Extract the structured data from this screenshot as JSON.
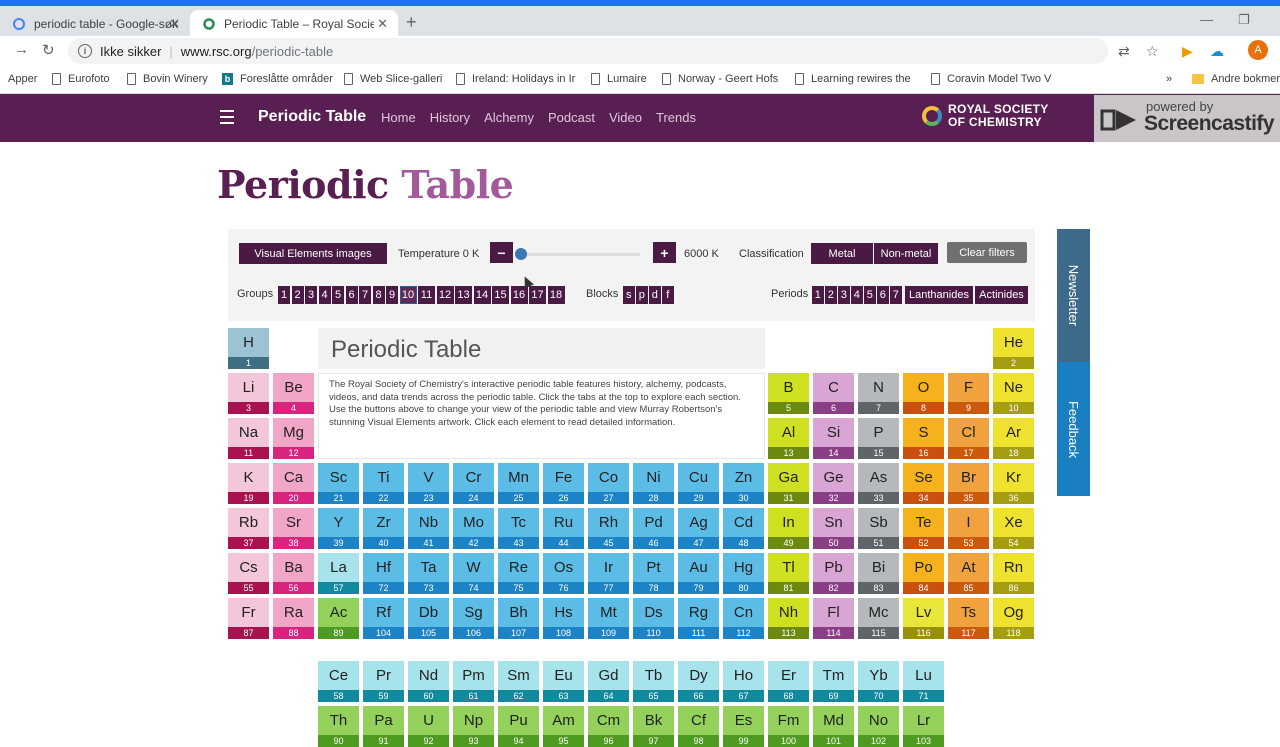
{
  "browser": {
    "tabs": [
      {
        "title": "periodic table - Google-søk",
        "active": false
      },
      {
        "title": "Periodic Table – Royal Society of",
        "active": true
      }
    ],
    "url_host": "www.rsc.org",
    "url_path": "/periodic-table",
    "insecure_label": "Ikke sikker",
    "bookmarks": [
      {
        "label": "Apper",
        "icon": "apps-icon"
      },
      {
        "label": "Eurofoto",
        "icon": "page-icon"
      },
      {
        "label": "Bovin Winery",
        "icon": "page-icon"
      },
      {
        "label": "Foreslåtte områder",
        "icon": "bing-icon"
      },
      {
        "label": "Web Slice-galleri",
        "icon": "page-icon"
      },
      {
        "label": "Ireland: Holidays in Ir",
        "icon": "page-icon"
      },
      {
        "label": "Lumaire",
        "icon": "page-icon"
      },
      {
        "label": "Norway - Geert Hofs",
        "icon": "page-icon"
      },
      {
        "label": "Learning rewires the",
        "icon": "page-icon"
      },
      {
        "label": "Coravin Model Two V",
        "icon": "page-icon"
      }
    ],
    "bookmarks_overflow": "»",
    "other_bookmarks": "Andre bokmerk",
    "avatar_letter": "A"
  },
  "site": {
    "title": "Periodic Table",
    "nav": [
      "Home",
      "History",
      "Alchemy",
      "Podcast",
      "Video",
      "Trends"
    ],
    "logo_line1": "ROYAL SOCIETY",
    "logo_line2": "OF CHEMISTRY"
  },
  "overlay": {
    "powered": "powered by",
    "brand": "Screencastify"
  },
  "page": {
    "heading_dark": "Periodic ",
    "heading_light": "Table"
  },
  "filters": {
    "visual_elements": "Visual Elements images",
    "temperature_label": "Temperature 0 K",
    "temp_min_btn": "−",
    "temp_plus_btn": "+",
    "temp_max": "6000 K",
    "temperature_fraction": 0.0,
    "classification_label": "Classification",
    "metal": "Metal",
    "nonmetal": "Non-metal",
    "clear": "Clear filters",
    "groups_label": "Groups",
    "groups": [
      "1",
      "2",
      "3",
      "4",
      "5",
      "6",
      "7",
      "8",
      "9",
      "10",
      "11",
      "12",
      "13",
      "14",
      "15",
      "16",
      "17",
      "18"
    ],
    "selected_group": "10",
    "blocks_label": "Blocks",
    "blocks": [
      "s",
      "p",
      "d",
      "f"
    ],
    "periods_label": "Periods",
    "periods": [
      "1",
      "2",
      "3",
      "4",
      "5",
      "6",
      "7"
    ],
    "lanthanides": "Lanthanides",
    "actinides": "Actinides"
  },
  "intro": {
    "title": "Periodic Table",
    "text": "The Royal Society of Chemistry's interactive periodic table features history, alchemy, podcasts, videos, and data trends across the periodic table. Click the tabs at the top to explore each section. Use the buttons above to change your view of the periodic table and view Murray Robertson's stunning Visual Elements artwork. Click each element to read detailed information."
  },
  "side_tabs": {
    "newsletter": "Newsletter",
    "feedback": "Feedback"
  },
  "colors": {
    "alkali": [
      "#f4c6d9",
      "#a7124f"
    ],
    "alkaline": [
      "#f1a6c8",
      "#d8237f"
    ],
    "transition": [
      "#5bbce6",
      "#1c84c6"
    ],
    "lanthanide": [
      "#a7e3ea",
      "#128a9e"
    ],
    "actinide": [
      "#93d15a",
      "#4f9a20"
    ],
    "post": [
      "#cfe021",
      "#6d8a10"
    ],
    "metalloid": [
      "#d8a5d4",
      "#8a3e86"
    ],
    "nonmetal": [
      "#b6b9bb",
      "#5e6468"
    ],
    "chalcogen": [
      "#f5b21c",
      "#c9500e"
    ],
    "halogen": [
      "#f0a23e",
      "#cc5a0d"
    ],
    "noble": [
      "#eee22e",
      "#a59d12"
    ],
    "hydrogen": [
      "#9bc3d3",
      "#3e6f83"
    ],
    "unknown_metal": [
      "#e9e63a",
      "#9a8f0a"
    ]
  },
  "elements": [
    {
      "s": "H",
      "n": "1",
      "c": "hydrogen",
      "col": 1,
      "row": 1
    },
    {
      "s": "He",
      "n": "2",
      "c": "noble",
      "col": 18,
      "row": 1
    },
    {
      "s": "Li",
      "n": "3",
      "c": "alkali",
      "col": 1,
      "row": 2
    },
    {
      "s": "Be",
      "n": "4",
      "c": "alkaline",
      "col": 2,
      "row": 2
    },
    {
      "s": "B",
      "n": "5",
      "c": "post",
      "col": 13,
      "row": 2
    },
    {
      "s": "C",
      "n": "6",
      "c": "metalloid",
      "col": 14,
      "row": 2
    },
    {
      "s": "N",
      "n": "7",
      "c": "nonmetal",
      "col": 15,
      "row": 2
    },
    {
      "s": "O",
      "n": "8",
      "c": "chalcogen",
      "col": 16,
      "row": 2
    },
    {
      "s": "F",
      "n": "9",
      "c": "halogen",
      "col": 17,
      "row": 2
    },
    {
      "s": "Ne",
      "n": "10",
      "c": "noble",
      "col": 18,
      "row": 2
    },
    {
      "s": "Na",
      "n": "11",
      "c": "alkali",
      "col": 1,
      "row": 3
    },
    {
      "s": "Mg",
      "n": "12",
      "c": "alkaline",
      "col": 2,
      "row": 3
    },
    {
      "s": "Al",
      "n": "13",
      "c": "post",
      "col": 13,
      "row": 3
    },
    {
      "s": "Si",
      "n": "14",
      "c": "metalloid",
      "col": 14,
      "row": 3
    },
    {
      "s": "P",
      "n": "15",
      "c": "nonmetal",
      "col": 15,
      "row": 3
    },
    {
      "s": "S",
      "n": "16",
      "c": "chalcogen",
      "col": 16,
      "row": 3
    },
    {
      "s": "Cl",
      "n": "17",
      "c": "halogen",
      "col": 17,
      "row": 3
    },
    {
      "s": "Ar",
      "n": "18",
      "c": "noble",
      "col": 18,
      "row": 3
    },
    {
      "s": "K",
      "n": "19",
      "c": "alkali",
      "col": 1,
      "row": 4
    },
    {
      "s": "Ca",
      "n": "20",
      "c": "alkaline",
      "col": 2,
      "row": 4
    },
    {
      "s": "Sc",
      "n": "21",
      "c": "transition",
      "col": 3,
      "row": 4
    },
    {
      "s": "Ti",
      "n": "22",
      "c": "transition",
      "col": 4,
      "row": 4
    },
    {
      "s": "V",
      "n": "23",
      "c": "transition",
      "col": 5,
      "row": 4
    },
    {
      "s": "Cr",
      "n": "24",
      "c": "transition",
      "col": 6,
      "row": 4
    },
    {
      "s": "Mn",
      "n": "25",
      "c": "transition",
      "col": 7,
      "row": 4
    },
    {
      "s": "Fe",
      "n": "26",
      "c": "transition",
      "col": 8,
      "row": 4
    },
    {
      "s": "Co",
      "n": "27",
      "c": "transition",
      "col": 9,
      "row": 4
    },
    {
      "s": "Ni",
      "n": "28",
      "c": "transition",
      "col": 10,
      "row": 4
    },
    {
      "s": "Cu",
      "n": "29",
      "c": "transition",
      "col": 11,
      "row": 4
    },
    {
      "s": "Zn",
      "n": "30",
      "c": "transition",
      "col": 12,
      "row": 4
    },
    {
      "s": "Ga",
      "n": "31",
      "c": "post",
      "col": 13,
      "row": 4
    },
    {
      "s": "Ge",
      "n": "32",
      "c": "metalloid",
      "col": 14,
      "row": 4
    },
    {
      "s": "As",
      "n": "33",
      "c": "nonmetal",
      "col": 15,
      "row": 4
    },
    {
      "s": "Se",
      "n": "34",
      "c": "chalcogen",
      "col": 16,
      "row": 4
    },
    {
      "s": "Br",
      "n": "35",
      "c": "halogen",
      "col": 17,
      "row": 4
    },
    {
      "s": "Kr",
      "n": "36",
      "c": "noble",
      "col": 18,
      "row": 4
    },
    {
      "s": "Rb",
      "n": "37",
      "c": "alkali",
      "col": 1,
      "row": 5
    },
    {
      "s": "Sr",
      "n": "38",
      "c": "alkaline",
      "col": 2,
      "row": 5
    },
    {
      "s": "Y",
      "n": "39",
      "c": "transition",
      "col": 3,
      "row": 5
    },
    {
      "s": "Zr",
      "n": "40",
      "c": "transition",
      "col": 4,
      "row": 5
    },
    {
      "s": "Nb",
      "n": "41",
      "c": "transition",
      "col": 5,
      "row": 5
    },
    {
      "s": "Mo",
      "n": "42",
      "c": "transition",
      "col": 6,
      "row": 5
    },
    {
      "s": "Tc",
      "n": "43",
      "c": "transition",
      "col": 7,
      "row": 5
    },
    {
      "s": "Ru",
      "n": "44",
      "c": "transition",
      "col": 8,
      "row": 5
    },
    {
      "s": "Rh",
      "n": "45",
      "c": "transition",
      "col": 9,
      "row": 5
    },
    {
      "s": "Pd",
      "n": "46",
      "c": "transition",
      "col": 10,
      "row": 5
    },
    {
      "s": "Ag",
      "n": "47",
      "c": "transition",
      "col": 11,
      "row": 5
    },
    {
      "s": "Cd",
      "n": "48",
      "c": "transition",
      "col": 12,
      "row": 5
    },
    {
      "s": "In",
      "n": "49",
      "c": "post",
      "col": 13,
      "row": 5
    },
    {
      "s": "Sn",
      "n": "50",
      "c": "metalloid",
      "col": 14,
      "row": 5
    },
    {
      "s": "Sb",
      "n": "51",
      "c": "nonmetal",
      "col": 15,
      "row": 5
    },
    {
      "s": "Te",
      "n": "52",
      "c": "chalcogen",
      "col": 16,
      "row": 5
    },
    {
      "s": "I",
      "n": "53",
      "c": "halogen",
      "col": 17,
      "row": 5
    },
    {
      "s": "Xe",
      "n": "54",
      "c": "noble",
      "col": 18,
      "row": 5
    },
    {
      "s": "Cs",
      "n": "55",
      "c": "alkali",
      "col": 1,
      "row": 6
    },
    {
      "s": "Ba",
      "n": "56",
      "c": "alkaline",
      "col": 2,
      "row": 6
    },
    {
      "s": "La",
      "n": "57",
      "c": "lanthanide",
      "col": 3,
      "row": 6
    },
    {
      "s": "Hf",
      "n": "72",
      "c": "transition",
      "col": 4,
      "row": 6
    },
    {
      "s": "Ta",
      "n": "73",
      "c": "transition",
      "col": 5,
      "row": 6
    },
    {
      "s": "W",
      "n": "74",
      "c": "transition",
      "col": 6,
      "row": 6
    },
    {
      "s": "Re",
      "n": "75",
      "c": "transition",
      "col": 7,
      "row": 6
    },
    {
      "s": "Os",
      "n": "76",
      "c": "transition",
      "col": 8,
      "row": 6
    },
    {
      "s": "Ir",
      "n": "77",
      "c": "transition",
      "col": 9,
      "row": 6
    },
    {
      "s": "Pt",
      "n": "78",
      "c": "transition",
      "col": 10,
      "row": 6
    },
    {
      "s": "Au",
      "n": "79",
      "c": "transition",
      "col": 11,
      "row": 6
    },
    {
      "s": "Hg",
      "n": "80",
      "c": "transition",
      "col": 12,
      "row": 6
    },
    {
      "s": "Tl",
      "n": "81",
      "c": "post",
      "col": 13,
      "row": 6
    },
    {
      "s": "Pb",
      "n": "82",
      "c": "metalloid",
      "col": 14,
      "row": 6
    },
    {
      "s": "Bi",
      "n": "83",
      "c": "nonmetal",
      "col": 15,
      "row": 6
    },
    {
      "s": "Po",
      "n": "84",
      "c": "chalcogen",
      "col": 16,
      "row": 6
    },
    {
      "s": "At",
      "n": "85",
      "c": "halogen",
      "col": 17,
      "row": 6
    },
    {
      "s": "Rn",
      "n": "86",
      "c": "noble",
      "col": 18,
      "row": 6
    },
    {
      "s": "Fr",
      "n": "87",
      "c": "alkali",
      "col": 1,
      "row": 7
    },
    {
      "s": "Ra",
      "n": "88",
      "c": "alkaline",
      "col": 2,
      "row": 7
    },
    {
      "s": "Ac",
      "n": "89",
      "c": "actinide",
      "col": 3,
      "row": 7
    },
    {
      "s": "Rf",
      "n": "104",
      "c": "transition",
      "col": 4,
      "row": 7
    },
    {
      "s": "Db",
      "n": "105",
      "c": "transition",
      "col": 5,
      "row": 7
    },
    {
      "s": "Sg",
      "n": "106",
      "c": "transition",
      "col": 6,
      "row": 7
    },
    {
      "s": "Bh",
      "n": "107",
      "c": "transition",
      "col": 7,
      "row": 7
    },
    {
      "s": "Hs",
      "n": "108",
      "c": "transition",
      "col": 8,
      "row": 7
    },
    {
      "s": "Mt",
      "n": "109",
      "c": "transition",
      "col": 9,
      "row": 7
    },
    {
      "s": "Ds",
      "n": "110",
      "c": "transition",
      "col": 10,
      "row": 7
    },
    {
      "s": "Rg",
      "n": "111",
      "c": "transition",
      "col": 11,
      "row": 7
    },
    {
      "s": "Cn",
      "n": "112",
      "c": "transition",
      "col": 12,
      "row": 7
    },
    {
      "s": "Nh",
      "n": "113",
      "c": "post",
      "col": 13,
      "row": 7
    },
    {
      "s": "Fl",
      "n": "114",
      "c": "metalloid",
      "col": 14,
      "row": 7
    },
    {
      "s": "Mc",
      "n": "115",
      "c": "nonmetal",
      "col": 15,
      "row": 7
    },
    {
      "s": "Lv",
      "n": "116",
      "c": "unknown_metal",
      "col": 16,
      "row": 7
    },
    {
      "s": "Ts",
      "n": "117",
      "c": "halogen",
      "col": 17,
      "row": 7
    },
    {
      "s": "Og",
      "n": "118",
      "c": "noble",
      "col": 18,
      "row": 7
    },
    {
      "s": "Ce",
      "n": "58",
      "c": "lanthanide",
      "col": 3,
      "row": 8
    },
    {
      "s": "Pr",
      "n": "59",
      "c": "lanthanide",
      "col": 4,
      "row": 8
    },
    {
      "s": "Nd",
      "n": "60",
      "c": "lanthanide",
      "col": 5,
      "row": 8
    },
    {
      "s": "Pm",
      "n": "61",
      "c": "lanthanide",
      "col": 6,
      "row": 8
    },
    {
      "s": "Sm",
      "n": "62",
      "c": "lanthanide",
      "col": 7,
      "row": 8
    },
    {
      "s": "Eu",
      "n": "63",
      "c": "lanthanide",
      "col": 8,
      "row": 8
    },
    {
      "s": "Gd",
      "n": "64",
      "c": "lanthanide",
      "col": 9,
      "row": 8
    },
    {
      "s": "Tb",
      "n": "65",
      "c": "lanthanide",
      "col": 10,
      "row": 8
    },
    {
      "s": "Dy",
      "n": "66",
      "c": "lanthanide",
      "col": 11,
      "row": 8
    },
    {
      "s": "Ho",
      "n": "67",
      "c": "lanthanide",
      "col": 12,
      "row": 8
    },
    {
      "s": "Er",
      "n": "68",
      "c": "lanthanide",
      "col": 13,
      "row": 8
    },
    {
      "s": "Tm",
      "n": "69",
      "c": "lanthanide",
      "col": 14,
      "row": 8
    },
    {
      "s": "Yb",
      "n": "70",
      "c": "lanthanide",
      "col": 15,
      "row": 8
    },
    {
      "s": "Lu",
      "n": "71",
      "c": "lanthanide",
      "col": 16,
      "row": 8
    },
    {
      "s": "Th",
      "n": "90",
      "c": "actinide",
      "col": 3,
      "row": 9
    },
    {
      "s": "Pa",
      "n": "91",
      "c": "actinide",
      "col": 4,
      "row": 9
    },
    {
      "s": "U",
      "n": "92",
      "c": "actinide",
      "col": 5,
      "row": 9
    },
    {
      "s": "Np",
      "n": "93",
      "c": "actinide",
      "col": 6,
      "row": 9
    },
    {
      "s": "Pu",
      "n": "94",
      "c": "actinide",
      "col": 7,
      "row": 9
    },
    {
      "s": "Am",
      "n": "95",
      "c": "actinide",
      "col": 8,
      "row": 9
    },
    {
      "s": "Cm",
      "n": "96",
      "c": "actinide",
      "col": 9,
      "row": 9
    },
    {
      "s": "Bk",
      "n": "97",
      "c": "actinide",
      "col": 10,
      "row": 9
    },
    {
      "s": "Cf",
      "n": "98",
      "c": "actinide",
      "col": 11,
      "row": 9
    },
    {
      "s": "Es",
      "n": "99",
      "c": "actinide",
      "col": 12,
      "row": 9
    },
    {
      "s": "Fm",
      "n": "100",
      "c": "actinide",
      "col": 13,
      "row": 9
    },
    {
      "s": "Md",
      "n": "101",
      "c": "actinide",
      "col": 14,
      "row": 9
    },
    {
      "s": "No",
      "n": "102",
      "c": "actinide",
      "col": 15,
      "row": 9
    },
    {
      "s": "Lr",
      "n": "103",
      "c": "actinide",
      "col": 16,
      "row": 9
    }
  ]
}
